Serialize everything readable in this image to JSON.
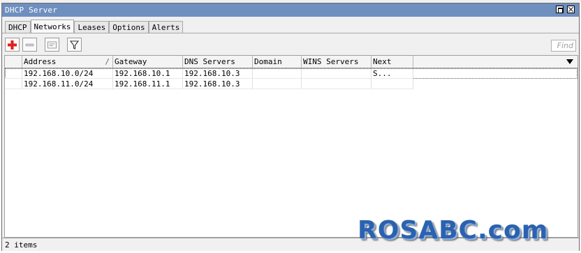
{
  "window": {
    "title": "DHCP Server"
  },
  "tabs": [
    "DHCP",
    "Networks",
    "Leases",
    "Options",
    "Alerts"
  ],
  "active_tab": "Networks",
  "toolbar": {
    "find_placeholder": "Find"
  },
  "table": {
    "columns": [
      "Address",
      "Gateway",
      "DNS Servers",
      "Domain",
      "WINS Servers",
      "Next S..."
    ],
    "sort_indicator": "/",
    "rows": [
      [
        "192.168.10.0/24",
        "192.168.10.1",
        "192.168.10.3",
        "",
        "",
        ""
      ],
      [
        "192.168.11.0/24",
        "192.168.11.1",
        "192.168.10.3",
        "",
        "",
        ""
      ]
    ]
  },
  "status": {
    "text": "2 items"
  },
  "watermark": "ROSABC.com",
  "colors": {
    "titlebar": "#6f8fbf",
    "add_icon": "#e0201c",
    "watermark": "#2a62b0"
  }
}
